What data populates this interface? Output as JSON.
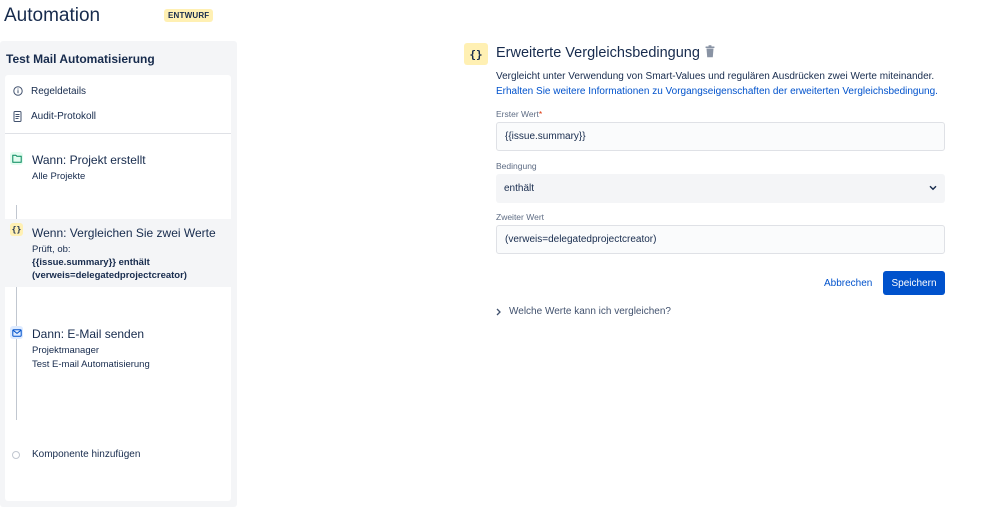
{
  "header": {
    "title": "Automation",
    "badge": "ENTWURF"
  },
  "sidebar": {
    "rule_name": "Test Mail Automatisierung",
    "nav": [
      {
        "label": "Regeldetails",
        "icon": "info-icon"
      },
      {
        "label": "Audit-Protokoll",
        "icon": "document-icon"
      }
    ],
    "steps": [
      {
        "title": "Wann: Projekt erstellt",
        "lines": [
          "Alle Projekte"
        ],
        "icon": "folder-icon"
      },
      {
        "title": "Wenn: Vergleichen Sie zwei Werte",
        "lines": [
          "Prüft, ob:",
          "{{issue.summary}} enthält",
          "(verweis=delegatedprojectcreator)"
        ],
        "icon": "braces-icon"
      },
      {
        "title": "Dann: E-Mail senden",
        "lines": [
          "Projektmanager",
          "Test E-mail Automatisierung"
        ],
        "icon": "mail-icon"
      }
    ],
    "add_component": "Komponente hinzufügen"
  },
  "main": {
    "icon_glyph": "{}",
    "title": "Erweiterte Vergleichsbedingung",
    "description": "Vergleicht unter Verwendung von Smart-Values und regulären Ausdrücken zwei Werte miteinander.",
    "link": "Erhalten Sie weitere Informationen zu Vorgangseigenschaften der erweiterten Vergleichsbedingung.",
    "first_value": {
      "label": "Erster Wert",
      "required": "*",
      "value": "{{issue.summary}}"
    },
    "condition": {
      "label": "Bedingung",
      "value": "enthält"
    },
    "second_value": {
      "label": "Zweiter Wert",
      "value": "(verweis=delegatedprojectcreator)"
    },
    "cancel_label": "Abbrechen",
    "save_label": "Speichern",
    "expander_label": "Welche Werte kann ich vergleichen?"
  },
  "colors": {
    "primary": "#0052cc",
    "badge_bg": "#fff0b3",
    "trigger_icon_bg": "#e3fcef",
    "action_icon_bg": "#deebff"
  }
}
